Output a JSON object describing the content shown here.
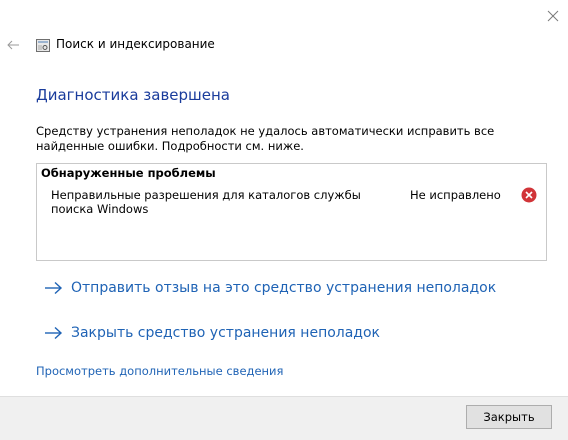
{
  "window": {
    "title": "Поиск и индексирование",
    "back_icon": "back-arrow-icon",
    "close_icon": "close-icon",
    "app_icon": "search-indexing-icon"
  },
  "main": {
    "heading": "Диагностика завершена",
    "description": "Средству устранения неполадок не удалось автоматически исправить все найденные ошибки. Подробности см. ниже.",
    "problems": {
      "header": "Обнаруженные проблемы",
      "items": [
        {
          "name": "Неправильные разрешения для каталогов службы поиска Windows",
          "status": "Не исправлено",
          "status_icon": "error-icon"
        }
      ]
    },
    "links": [
      {
        "label": "Отправить отзыв на это средство устранения неполадок",
        "icon": "arrow-right-icon"
      },
      {
        "label": "Закрыть средство устранения неполадок",
        "icon": "arrow-right-icon"
      }
    ],
    "details_link": "Просмотреть дополнительные сведения"
  },
  "footer": {
    "close_label": "Закрыть"
  },
  "colors": {
    "heading": "#1a3c9c",
    "link": "#1f63b5",
    "error": "#d13438",
    "footer_bg": "#f0f0f0"
  }
}
